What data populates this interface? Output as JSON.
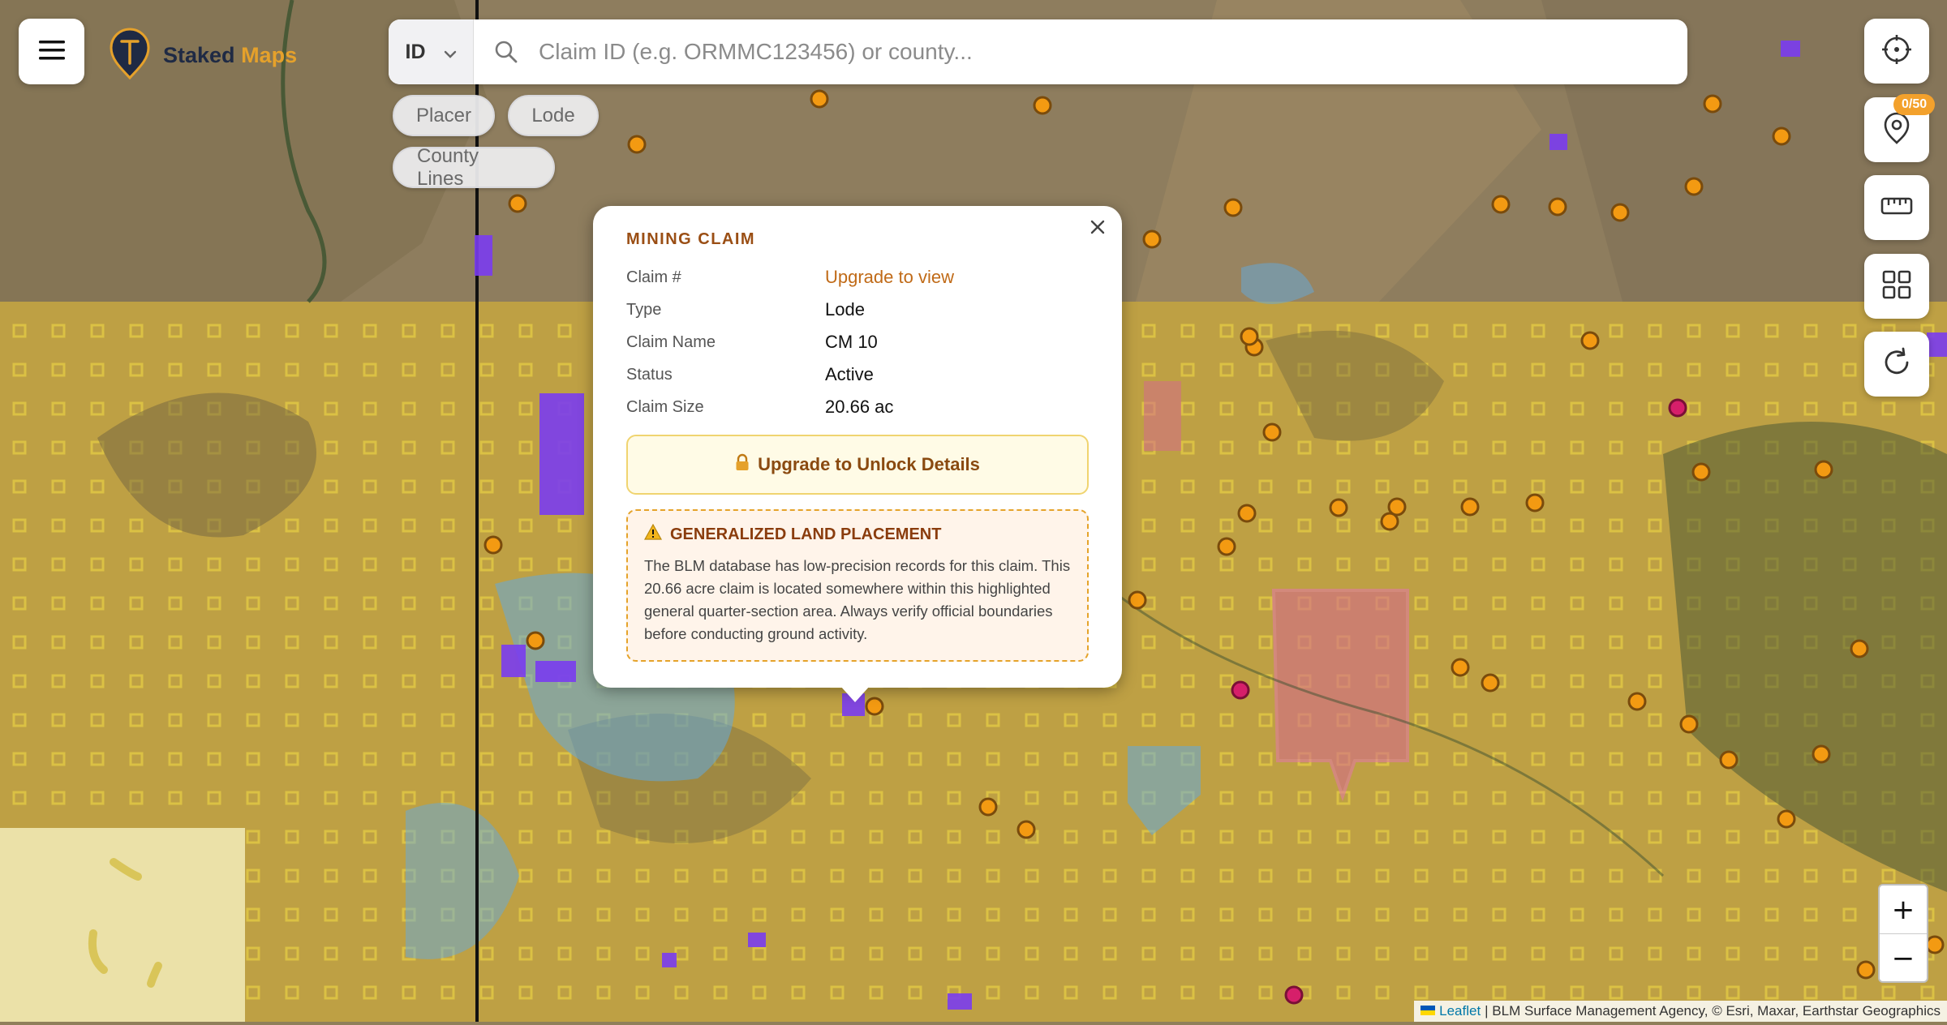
{
  "app": {
    "brand_part1": "Staked",
    "brand_part2": "Maps"
  },
  "search": {
    "state": "ID",
    "placeholder": "Claim ID (e.g. ORMMC123456) or county..."
  },
  "filters": {
    "placer": "Placer",
    "lode": "Lode",
    "county_lines": "County Lines"
  },
  "right_toolbar": {
    "claims_badge": "0/50"
  },
  "popup": {
    "title": "MINING CLAIM",
    "rows": [
      {
        "label": "Claim #",
        "value": "Upgrade to view"
      },
      {
        "label": "Type",
        "value": "Lode"
      },
      {
        "label": "Claim Name",
        "value": "CM 10"
      },
      {
        "label": "Status",
        "value": "Active"
      },
      {
        "label": "Claim Size",
        "value": "20.66 ac"
      }
    ],
    "unlock_label": "Upgrade to Unlock Details",
    "warning_title": "GENERALIZED LAND PLACEMENT",
    "warning_text": "The BLM database has low-precision records for this claim. This 20.66 acre claim is located somewhere within this highlighted general quarter-section area. Always verify official boundaries before conducting ground activity."
  },
  "zoom": {
    "in": "+",
    "out": "−"
  },
  "attribution": {
    "leaflet": "Leaflet",
    "text": "| BLM Surface Management Agency, © Esri, Maxar, Earthstar Geographics"
  },
  "colors": {
    "accent": "#e5a12b",
    "brand_dark": "#1f2a44",
    "lode_marker": "#f39a12",
    "placer_marker": "#7a3cf0",
    "blm_land": "#c9a83a",
    "other_land": "#d46b8a",
    "water": "#62aadf"
  }
}
